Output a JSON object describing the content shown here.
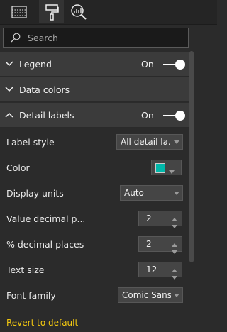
{
  "toolbar": {
    "tabs": [
      {
        "icon": "fields-icon",
        "active": false
      },
      {
        "icon": "paint-roller-icon",
        "active": true
      },
      {
        "icon": "analytics-magnifier-icon",
        "active": false
      }
    ]
  },
  "search": {
    "placeholder": "Search",
    "value": ""
  },
  "sections": {
    "legend": {
      "title": "Legend",
      "state": "On",
      "expanded": false
    },
    "data_colors": {
      "title": "Data colors",
      "expanded": false
    },
    "detail_labels": {
      "title": "Detail labels",
      "state": "On",
      "expanded": true
    }
  },
  "detail_labels": {
    "label_style": {
      "label": "Label style",
      "value": "All detail la..."
    },
    "color": {
      "label": "Color",
      "value": "#01b8aa"
    },
    "display_units": {
      "label": "Display units",
      "value": "Auto"
    },
    "value_decimal": {
      "label": "Value decimal p...",
      "value": "2"
    },
    "percent_decimal": {
      "label": "% decimal places",
      "value": "2"
    },
    "text_size": {
      "label": "Text size",
      "value": "12"
    },
    "font_family": {
      "label": "Font family",
      "value": "Comic Sans..."
    },
    "revert": "Revert to default"
  },
  "colors": {
    "accent": "#f2c811",
    "teal": "#01b8aa",
    "panel": "#2b2b2b",
    "section": "#3b3b3b"
  }
}
